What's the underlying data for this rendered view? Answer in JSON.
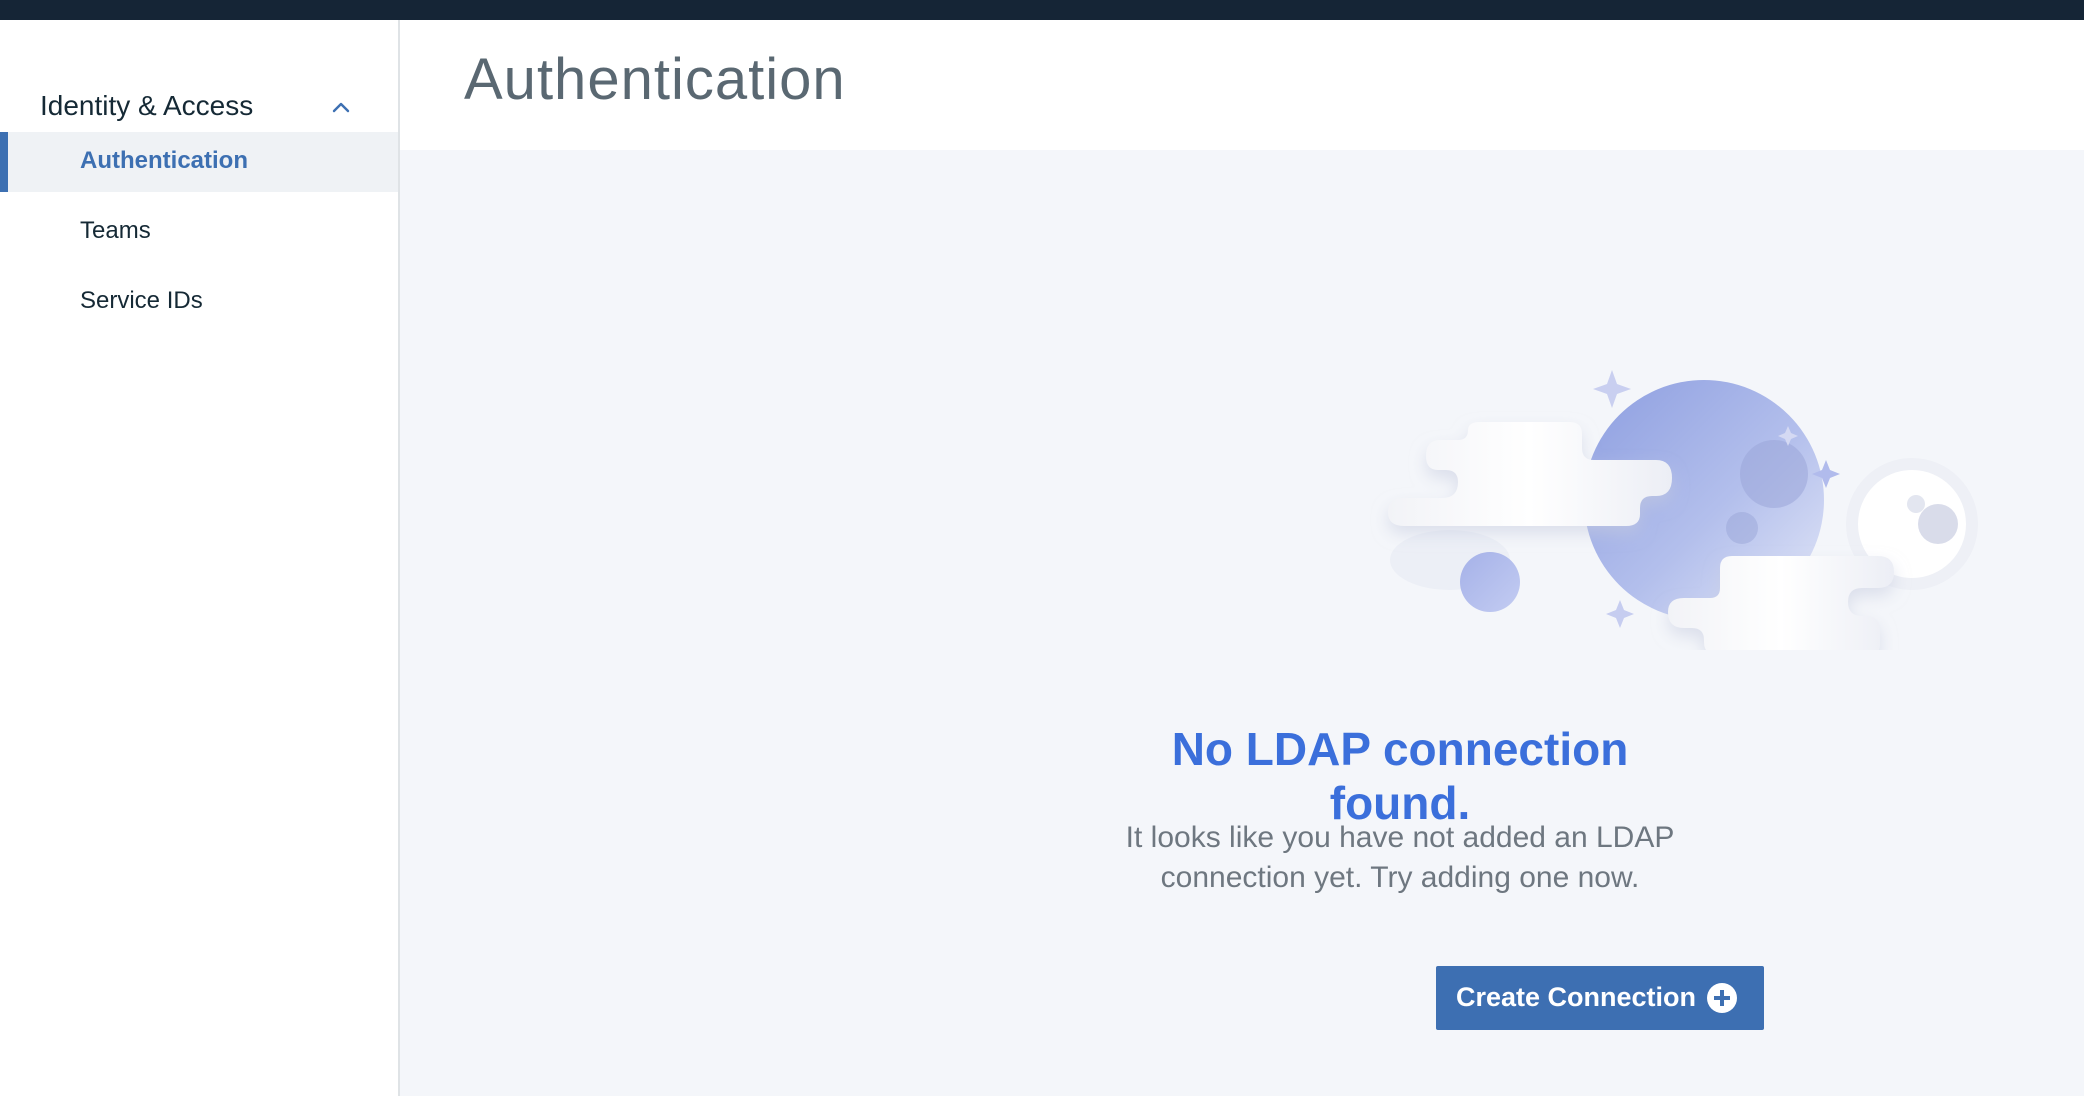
{
  "sidebar": {
    "section_label": "Identity & Access",
    "items": [
      {
        "label": "Authentication",
        "active": true
      },
      {
        "label": "Teams",
        "active": false
      },
      {
        "label": "Service IDs",
        "active": false
      }
    ]
  },
  "header": {
    "title": "Authentication"
  },
  "empty_state": {
    "heading": "No LDAP connection found.",
    "description": "It looks like you have not added an LDAP connection yet. Try adding one now.",
    "button_label": "Create Connection",
    "button_icon": "plus-circle-icon",
    "illustration": "moon-clouds-illustration"
  },
  "colors": {
    "topbar": "#152536",
    "accent": "#3d70b2",
    "heading": "#3b6fdb",
    "content_bg": "#f4f6fa",
    "active_item_bg": "#eff2f5"
  }
}
